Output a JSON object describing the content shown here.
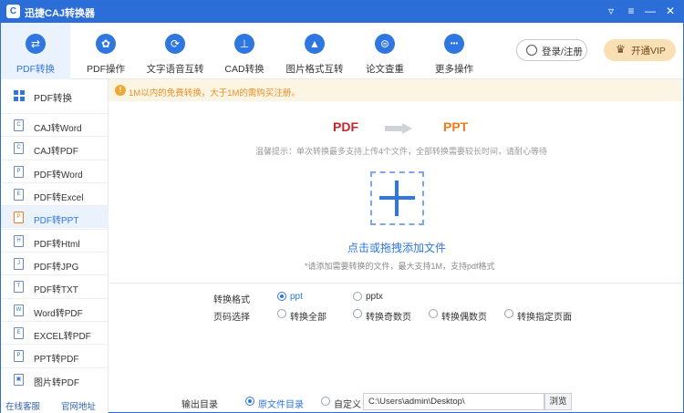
{
  "window": {
    "title": "迅捷CAJ转换器",
    "logo_glyph": "C"
  },
  "window_controls": {
    "skin": "▿",
    "menu": "≡",
    "minimize": "—",
    "close": "✕"
  },
  "toolbar": {
    "items": [
      {
        "label": "PDF转换",
        "glyph": "⇄",
        "active": true
      },
      {
        "label": "PDF操作",
        "glyph": "✿",
        "active": false
      },
      {
        "label": "文字语音互转",
        "glyph": "⟳",
        "active": false
      },
      {
        "label": "CAD转换",
        "glyph": "⊥",
        "active": false
      },
      {
        "label": "图片格式互转",
        "glyph": "▲",
        "active": false
      },
      {
        "label": "论文查重",
        "glyph": "⊜",
        "active": false
      },
      {
        "label": "更多操作",
        "glyph": "•••",
        "active": false
      }
    ],
    "login_label": "登录/注册",
    "vip_label": "开通VIP",
    "vip_glyph": "♛"
  },
  "sidebar": {
    "header": "PDF转换",
    "items": [
      {
        "label": "CAJ转Word",
        "glyph": "C"
      },
      {
        "label": "CAJ转PDF",
        "glyph": "C"
      },
      {
        "label": "PDF转Word",
        "glyph": "P"
      },
      {
        "label": "PDF转Excel",
        "glyph": "E"
      },
      {
        "label": "PDF转PPT",
        "glyph": "P"
      },
      {
        "label": "PDF转Html",
        "glyph": "H"
      },
      {
        "label": "PDF转JPG",
        "glyph": "J"
      },
      {
        "label": "PDF转TXT",
        "glyph": "T"
      },
      {
        "label": "Word转PDF",
        "glyph": "W"
      },
      {
        "label": "EXCEL转PDF",
        "glyph": "E"
      },
      {
        "label": "PPT转PDF",
        "glyph": "P"
      },
      {
        "label": "图片转PDF",
        "glyph": "▣"
      }
    ],
    "active_index": 4,
    "footer_service": "在线客服",
    "footer_site": "官网地址"
  },
  "notice": {
    "text": "1M以内的免费转换，大于1M的需购买注册。",
    "glyph": "!"
  },
  "conversion": {
    "from": "PDF",
    "to": "PPT"
  },
  "tip": "温馨提示：单次转换最多支持上传4个文件，全部转换需要较长时间，请耐心等待",
  "drop": {
    "label": "点击或拖拽添加文件",
    "sub": "*请添加需要转换的文件，最大支持1M，支持pdf格式"
  },
  "options": {
    "format_label": "转换格式",
    "formats": [
      "ppt",
      "pptx"
    ],
    "format_selected": "ppt",
    "pages_label": "页码选择",
    "pages": [
      "转换全部",
      "转换奇数页",
      "转换偶数页",
      "转换指定页面"
    ],
    "pages_selected": null
  },
  "output": {
    "label": "输出目录",
    "options": [
      "原文件目录",
      "自定义"
    ],
    "selected": "原文件目录",
    "path": "C:\\Users\\admin\\Desktop\\",
    "browse_label": "浏览"
  },
  "colors": {
    "brand": "#2c6ed8",
    "accent": "#2f76e0",
    "pdf": "#c8242b",
    "ppt": "#ef7b1c",
    "warning": "#e68f2a",
    "vip_bg": "#f9dfb4"
  }
}
